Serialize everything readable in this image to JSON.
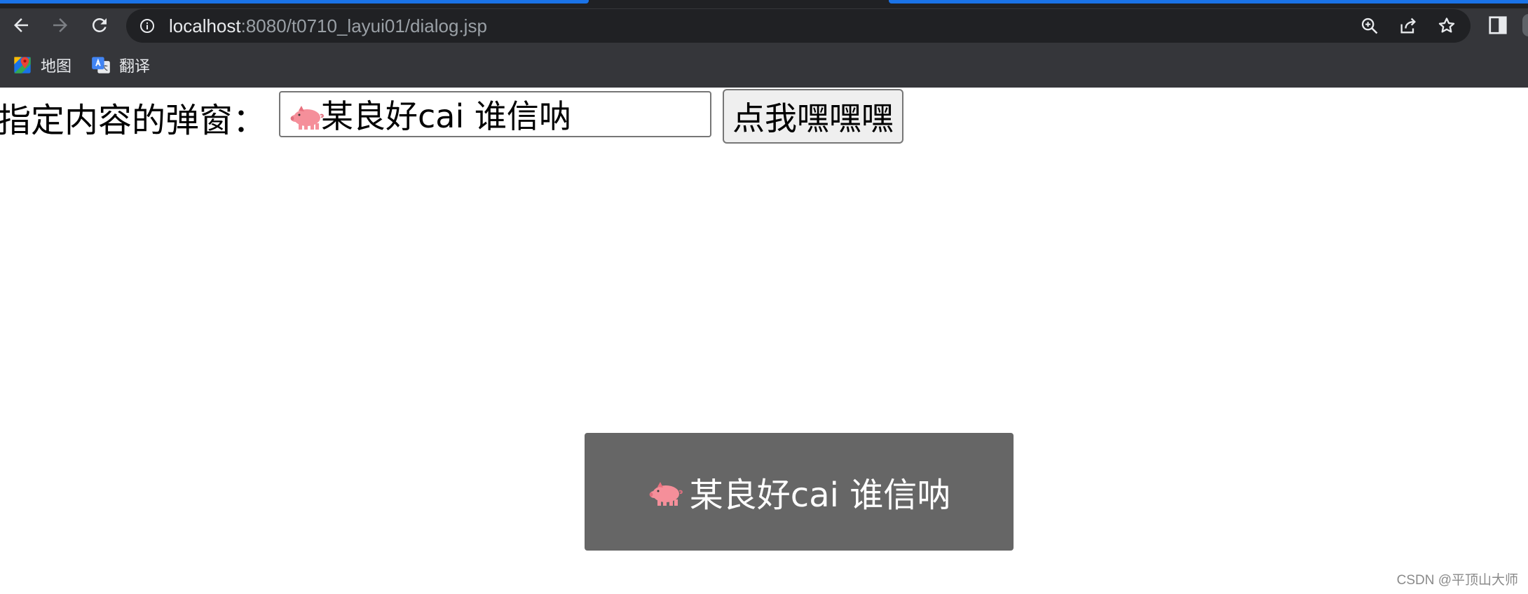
{
  "browser": {
    "url_host": "localhost",
    "url_path": ":8080/t0710_layui01/dialog.jsp",
    "bookmarks": [
      {
        "label": "地图",
        "icon": "google-maps-icon"
      },
      {
        "label": "翻译",
        "icon": "google-translate-icon"
      }
    ],
    "accent_color": "#1a73e8"
  },
  "page": {
    "label": "指定内容的弹窗：",
    "input_value": "某良好cai 谁信呐",
    "input_emoji": "pig-icon",
    "button_label": "点我嘿嘿嘿"
  },
  "dialog": {
    "message": "某良好cai 谁信呐",
    "emoji": "pig-icon",
    "background": "#666666"
  },
  "watermark": "CSDN @平顶山大师"
}
